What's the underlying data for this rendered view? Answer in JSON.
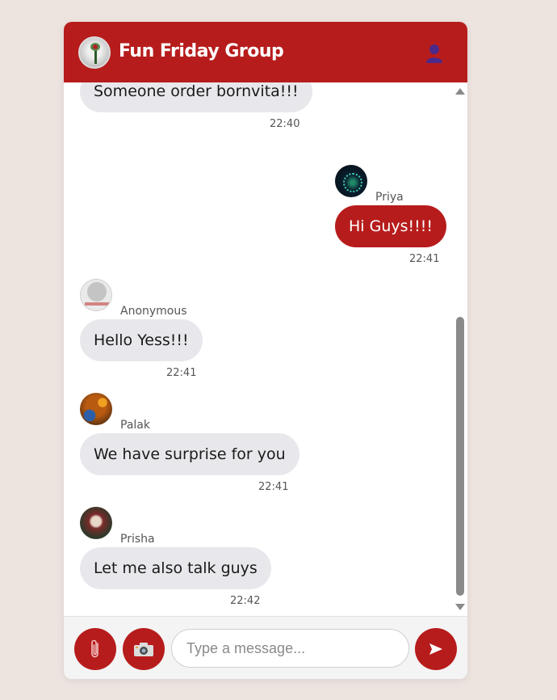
{
  "header": {
    "title": "Fun Friday Group",
    "group_avatar_icon": "group-photo",
    "members_icon": "user-icon"
  },
  "messages": [
    {
      "direction": "incoming",
      "sender": "",
      "text": "Someone order bornvita!!!",
      "time": "22:40"
    },
    {
      "direction": "outgoing",
      "sender": "Priya",
      "text": "Hi Guys!!!!",
      "time": "22:41"
    },
    {
      "direction": "incoming",
      "sender": "Anonymous",
      "text": "Hello Yess!!!",
      "time": "22:41"
    },
    {
      "direction": "incoming",
      "sender": "Palak",
      "text": "We have surprise for you",
      "time": "22:41"
    },
    {
      "direction": "incoming",
      "sender": "Prisha",
      "text": "Let me also talk guys",
      "time": "22:42"
    }
  ],
  "composer": {
    "placeholder": "Type a message...",
    "value": "",
    "attach_icon": "paperclip-icon",
    "camera_icon": "camera-icon",
    "send_icon": "send-icon"
  },
  "colors": {
    "accent": "#b71c1c",
    "background": "#ede4e0",
    "incoming_bubble": "#e8e8ec",
    "outgoing_bubble": "#b71c1c"
  }
}
